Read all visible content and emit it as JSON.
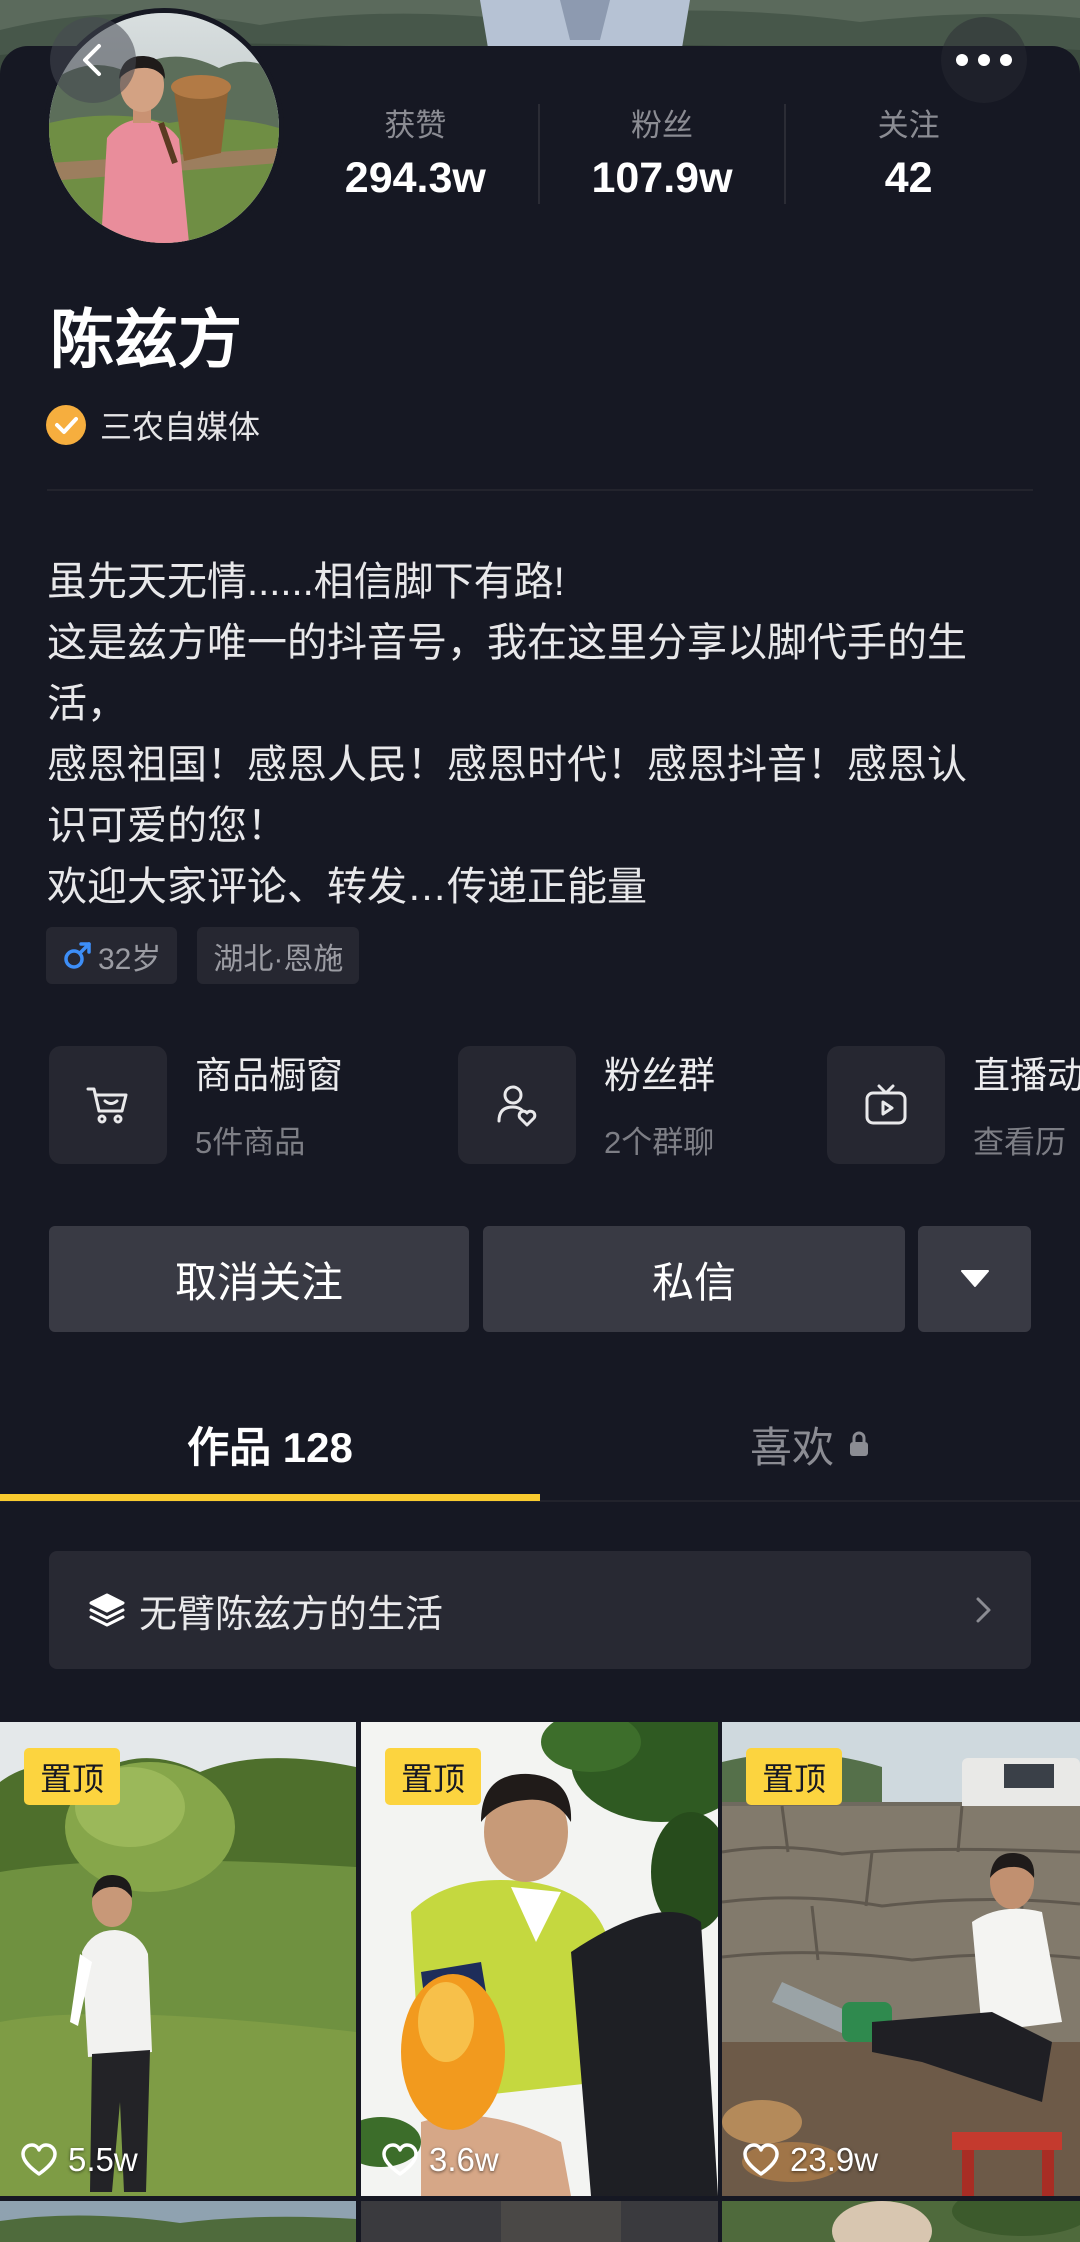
{
  "nav": {
    "back_icon": "chevron-left-icon",
    "more_icon": "more-dots-icon"
  },
  "profile": {
    "name": "陈兹方",
    "verified_icon": "verified-check-icon",
    "verified_label": "三农自媒体",
    "stats": [
      {
        "label": "获赞",
        "value": "294.3w"
      },
      {
        "label": "粉丝",
        "value": "107.9w"
      },
      {
        "label": "关注",
        "value": "42"
      }
    ],
    "bio_lines": [
      "虽先天无情......相信脚下有路!",
      "这是兹方唯一的抖音号，我在这里分享以脚代手的生",
      "活，",
      "感恩祖国！感恩人民！感恩时代！感恩抖音！感恩认",
      "识可爱的您！",
      "欢迎大家评论、转发…传递正能量"
    ],
    "tags": [
      {
        "icon": "male-icon",
        "text": "32岁"
      },
      {
        "text": "湖北·恩施"
      }
    ]
  },
  "features": [
    {
      "icon": "cart-icon",
      "title": "商品橱窗",
      "subtitle": "5件商品"
    },
    {
      "icon": "fan-group-icon",
      "title": "粉丝群",
      "subtitle": "2个群聊"
    },
    {
      "icon": "live-tv-icon",
      "title": "直播动",
      "subtitle": "查看历"
    }
  ],
  "actions": {
    "unfollow_label": "取消关注",
    "message_label": "私信",
    "more_icon": "caret-down-icon"
  },
  "tabs": [
    {
      "label": "作品 128",
      "active": true
    },
    {
      "label": "喜欢",
      "active": false,
      "icon": "lock-icon"
    }
  ],
  "collection": {
    "icon": "layers-icon",
    "title": "无臂陈兹方的生活",
    "chevron_icon": "chevron-right-icon"
  },
  "videos": [
    {
      "pinned_label": "置顶",
      "likes": "5.5w",
      "likes_icon": "heart-outline-icon"
    },
    {
      "pinned_label": "置顶",
      "likes": "3.6w",
      "likes_icon": "heart-outline-icon"
    },
    {
      "pinned_label": "置顶",
      "likes": "23.9w",
      "likes_icon": "heart-outline-icon"
    }
  ],
  "colors": {
    "background": "#161823",
    "tab_indicator": "#f9cb2f",
    "pinned_badge": "#fcd43f",
    "verified": "#f6ae3e",
    "male": "#3d8ef7",
    "button": "#393a44",
    "card": "#262731"
  }
}
